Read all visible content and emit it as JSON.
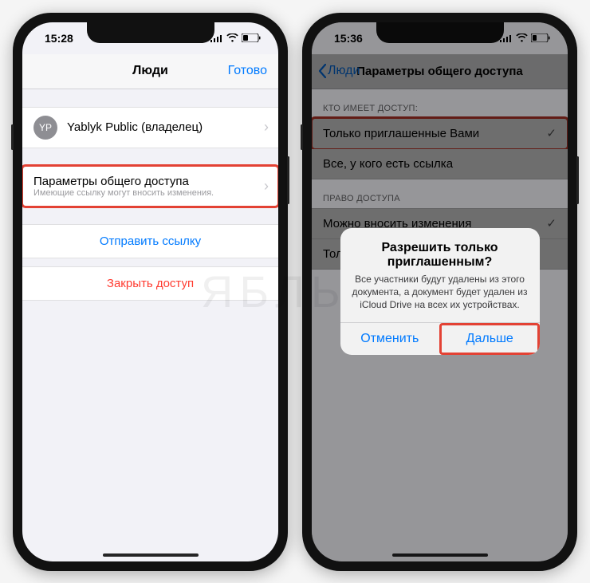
{
  "watermark": "ЯБЛЫК",
  "left": {
    "time": "15:28",
    "nav_title": "Люди",
    "nav_done": "Готово",
    "owner_initials": "YP",
    "owner_label": "Yablyk Public (владелец)",
    "sharing_params_title": "Параметры общего доступа",
    "sharing_params_sub": "Имеющие ссылку могут вносить изменения.",
    "send_link": "Отправить ссылку",
    "stop_sharing": "Закрыть доступ"
  },
  "right": {
    "time": "15:36",
    "nav_back": "Люди",
    "nav_title": "Параметры общего доступа",
    "section_who": "КТО ИМЕЕТ ДОСТУП:",
    "opt_invited": "Только приглашенные Вами",
    "opt_link": "Все, у кого есть ссылка",
    "section_rights": "ПРАВО ДОСТУПА",
    "opt_edit": "Можно вносить изменения",
    "opt_view": "Только просмотр",
    "alert_title": "Разрешить только приглашенным?",
    "alert_message": "Все участники будут удалены из этого документа, а документ будет удален из iCloud Drive на всех их устройствах.",
    "alert_cancel": "Отменить",
    "alert_continue": "Дальше"
  }
}
